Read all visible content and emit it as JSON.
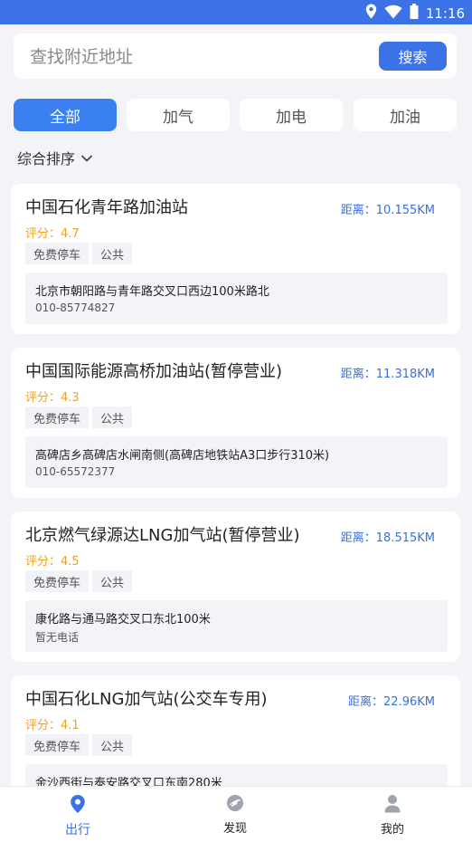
{
  "status_bar": {
    "time": "11:16",
    "icons": [
      "location-icon",
      "wifi-icon",
      "battery-icon"
    ]
  },
  "search": {
    "placeholder": "查找附近地址",
    "value": "",
    "button_label": "搜索"
  },
  "filter_tabs": [
    {
      "label": "全部",
      "active": true
    },
    {
      "label": "加气",
      "active": false
    },
    {
      "label": "加电",
      "active": false
    },
    {
      "label": "加油",
      "active": false
    }
  ],
  "sort": {
    "label": "综合排序"
  },
  "stations": [
    {
      "name": "中国石化青年路加油站",
      "distance": "距离：10.155KM",
      "rating": "评分：4.7",
      "tags": [
        "免费停车",
        "公共"
      ],
      "address": "北京市朝阳路与青年路交叉口西边100米路北",
      "phone": "010-85774827"
    },
    {
      "name": "中国国际能源高桥加油站(暂停营业)",
      "distance": "距离：11.318KM",
      "rating": "评分：4.3",
      "tags": [
        "免费停车",
        "公共"
      ],
      "address": "高碑店乡高碑店水闸南侧(高碑店地铁站A3口步行310米)",
      "phone": "010-65572377"
    },
    {
      "name": "北京燃气绿源达LNG加气站(暂停营业)",
      "distance": "距离：18.515KM",
      "rating": "评分：4.5",
      "tags": [
        "免费停车",
        "公共"
      ],
      "address": "康化路与通马路交叉口东北100米",
      "phone": "暂无电话"
    },
    {
      "name": "中国石化LNG加气站(公交车专用)",
      "distance": "距离：22.96KM",
      "rating": "评分：4.1",
      "tags": [
        "免费停车",
        "公共"
      ],
      "address": "金沙西街与泰安路交叉口东南280米",
      "phone": ""
    }
  ],
  "bottom_nav": [
    {
      "label": "出行",
      "icon": "location-pin-icon",
      "active": true
    },
    {
      "label": "发现",
      "icon": "discover-icon",
      "active": false
    },
    {
      "label": "我的",
      "icon": "user-icon",
      "active": false
    }
  ],
  "colors": {
    "accent": "#3b73e6",
    "rating": "#f0a020",
    "distance": "#3b6fd8"
  }
}
